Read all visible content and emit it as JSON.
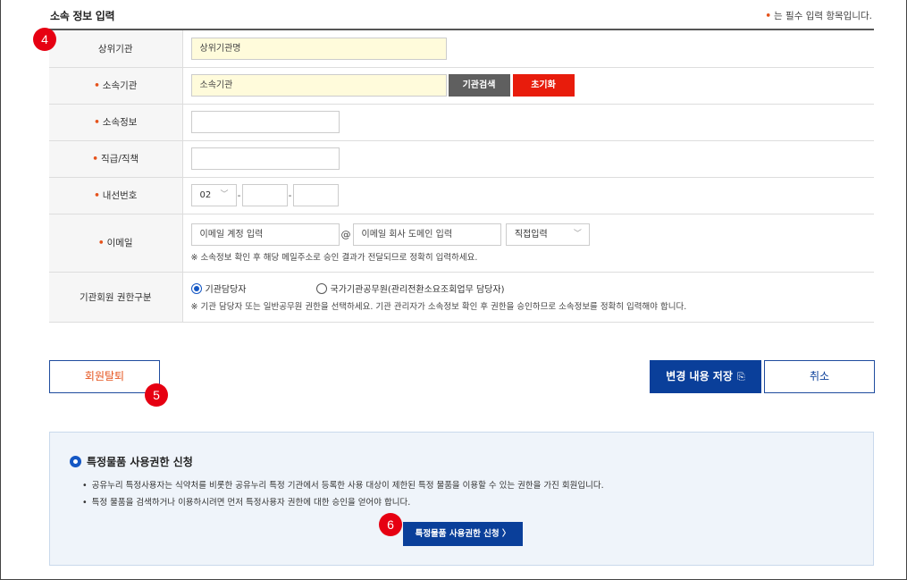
{
  "section": {
    "title": "소속 정보 입력",
    "required_note": "는 필수 입력 항목입니다.",
    "required_mark": "•"
  },
  "badges": {
    "b4": "4",
    "b5": "5",
    "b6": "6"
  },
  "form": {
    "parent_org": {
      "label": "상위기관",
      "value": "상위기관명"
    },
    "org": {
      "label": "소속기관",
      "value": "소속기관",
      "search_button": "기관검색",
      "reset_button": "초기화"
    },
    "dept": {
      "label": "소속정보",
      "value": ""
    },
    "position": {
      "label": "직급/직책",
      "value": ""
    },
    "phone": {
      "label": "내선번호",
      "area_code": "02",
      "part2": "",
      "part3": ""
    },
    "email": {
      "label": "이메일",
      "id_placeholder": "이메일 계정 입력",
      "at": "@",
      "domain_placeholder": "이메일 회사 도메인 입력",
      "domain_select": "직접입력",
      "hint": "※ 소속정보 확인 후 해당 메일주소로 승인 결과가 전달되므로 정확히 입력하세요."
    },
    "role": {
      "label": "기관회원 권한구분",
      "option1": "기관담당자",
      "option2": "국가기관공무원(관리전환소요조회업무 담당자)",
      "selected": "기관담당자",
      "hint": "※ 기관 담당자 또는 일반공무원 권한을 선택하세요. 기관 관리자가 소속정보 확인 후 권한을 승인하므로 소속정보를 정확히 입력해야 합니다."
    }
  },
  "actions": {
    "withdraw": "회원탈퇴",
    "save": "변경 내용 저장",
    "cancel": "취소"
  },
  "special_panel": {
    "title": "특정물품 사용권한 신청",
    "bullets": [
      "공유누리 특정사용자는 식약처를 비롯한 공유누리 특정 기관에서 등록한 사용 대상이 제한된 특정 물품을 이용할 수 있는 권한을 가진 회원입니다.",
      "특정 물품을 검색하거나 이용하시려면 먼저 특정사용자 권한에 대한 승인을 얻어야 합니다."
    ],
    "apply_button": "특정물품 사용권한 신청"
  },
  "colors": {
    "accent": "#0a3f9a",
    "required": "#e5531c",
    "badge": "#e60012",
    "reset": "#e81c0c"
  }
}
